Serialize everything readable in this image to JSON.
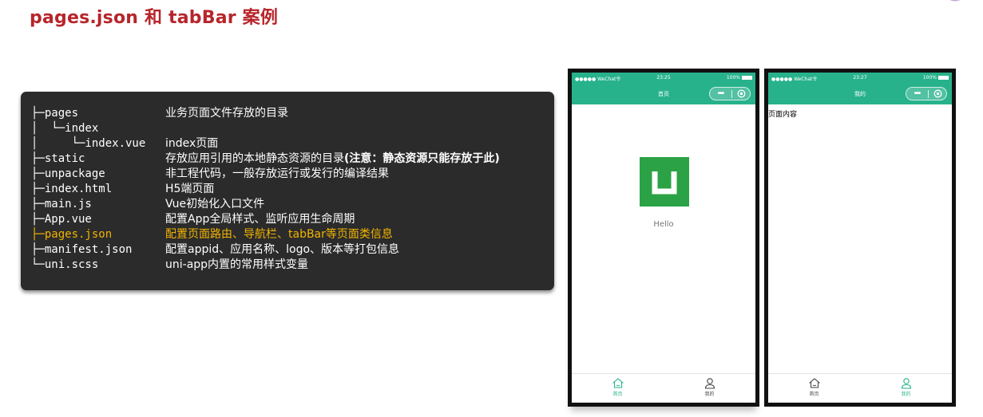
{
  "slide": {
    "title": "pages.json 和 tabBar 案例"
  },
  "colors": {
    "title": "#b7252b",
    "highlight": "#f2b400",
    "wechat_green": "#28b28b",
    "tab_active": "#28b28b",
    "tab_inactive": "#444444",
    "logo_green": "#2ba245"
  },
  "code_panel": {
    "rows": [
      {
        "tree": "├─pages",
        "desc": "业务页面文件存放的目录"
      },
      {
        "tree": "│  └─index",
        "desc": ""
      },
      {
        "tree": "│     └─index.vue",
        "desc": "index页面"
      },
      {
        "tree": "├─static",
        "desc": "存放应用引用的本地静态资源的目录",
        "desc_bold": "(注意：静态资源只能存放于此)"
      },
      {
        "tree": "├─unpackage",
        "desc": "非工程代码，一般存放运行或发行的编译结果"
      },
      {
        "tree": "├─index.html",
        "desc": "H5端页面"
      },
      {
        "tree": "├─main.js",
        "desc": "Vue初始化入口文件"
      },
      {
        "tree": "├─App.vue",
        "desc": "配置App全局样式、监听应用生命周期"
      },
      {
        "tree": "├─pages.json",
        "desc": "配置页面路由、导航栏、tabBar等页面类信息"
      },
      {
        "tree": "├─manifest.json",
        "desc": "配置appid、应用名称、logo、版本等打包信息"
      },
      {
        "tree": "└─uni.scss",
        "desc": "uni-app内置的常用样式变量"
      }
    ],
    "highlight_row_index": 8
  },
  "phones": [
    {
      "status": {
        "carrier": "●●●●● WeChat令",
        "time": "23:25",
        "battery": "100%"
      },
      "nav_title": "首页",
      "capsule": {
        "menu_icon": "more-dots-icon",
        "close_icon": "target-circle-icon",
        "menu": "•••"
      },
      "content": {
        "hello": "Hello",
        "logo_icon": "uni-app-logo-icon"
      },
      "tabs": [
        {
          "label": "首页",
          "icon": "home-icon",
          "active": true
        },
        {
          "label": "我的",
          "icon": "user-icon",
          "active": false
        }
      ]
    },
    {
      "status": {
        "carrier": "●●●●● WeChat令",
        "time": "23:27",
        "battery": "100%"
      },
      "nav_title": "我的",
      "capsule": {
        "menu_icon": "more-dots-icon",
        "close_icon": "target-circle-icon",
        "menu": "•••"
      },
      "content": {
        "text": "页面内容"
      },
      "tabs": [
        {
          "label": "首页",
          "icon": "home-icon",
          "active": false
        },
        {
          "label": "我的",
          "icon": "user-icon",
          "active": true
        }
      ]
    }
  ]
}
